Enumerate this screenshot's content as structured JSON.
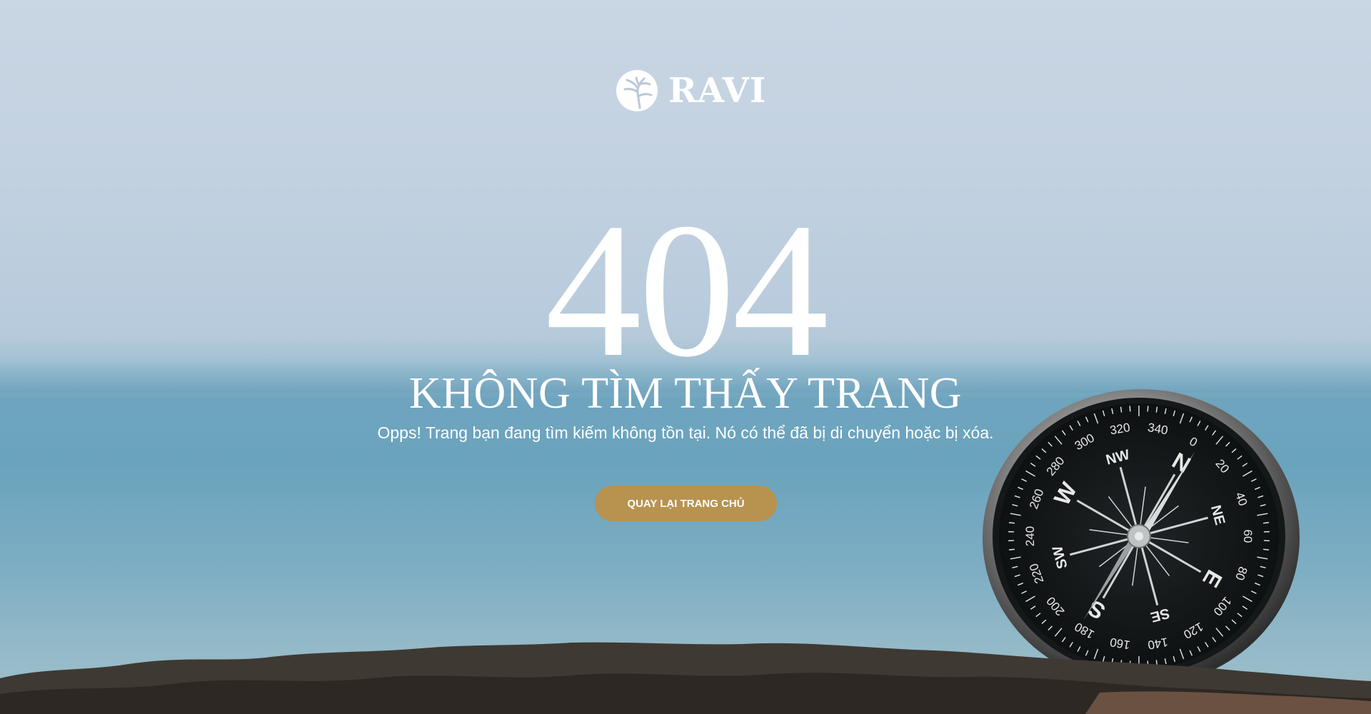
{
  "brand": {
    "name": "RAVI",
    "logo_icon": "tree-in-circle-icon",
    "color": "#ffffff"
  },
  "error": {
    "code": "404",
    "title": "KHÔNG TÌM THẤY TRANG",
    "message": "Opps! Trang bạn đang tìm kiếm không tồn tại. Nó có thể đã bị di chuyển hoặc bị xóa."
  },
  "actions": {
    "home_label": "QUAY LẠI TRANG CHỦ",
    "home_color": "#b8924f"
  },
  "background": {
    "scene": "compass-on-rock-by-sea",
    "compass_labels": [
      "N",
      "NE",
      "E",
      "SE",
      "S",
      "SW",
      "W",
      "NW"
    ],
    "compass_degrees": [
      "0",
      "20",
      "40",
      "60",
      "80",
      "100",
      "120",
      "140",
      "160",
      "180",
      "200",
      "220",
      "240",
      "260",
      "280",
      "300",
      "320",
      "340"
    ]
  }
}
